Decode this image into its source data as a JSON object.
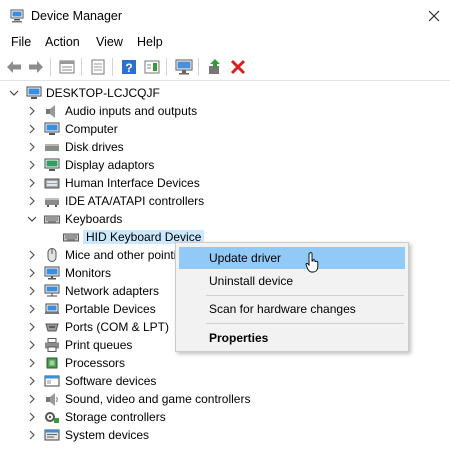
{
  "window": {
    "title": "Device Manager",
    "close_glyph": "✕"
  },
  "menu": [
    "File",
    "Action",
    "View",
    "Help"
  ],
  "toolbar": {
    "buttons": [
      "back-icon",
      "forward-icon",
      "properties-sheet-icon",
      "show-hidden-icon",
      "help-icon",
      "action-pane-icon",
      "scan-monitor-icon",
      "update-driver-icon",
      "uninstall-icon"
    ]
  },
  "tree": {
    "root": "DESKTOP-LCJCQJF",
    "items": [
      {
        "label": "Audio inputs and outputs",
        "icon": "speaker-icon",
        "expanded": false
      },
      {
        "label": "Computer",
        "icon": "computer-icon",
        "expanded": false
      },
      {
        "label": "Disk drives",
        "icon": "disk-drive-icon",
        "expanded": false
      },
      {
        "label": "Display adaptors",
        "icon": "display-adapter-icon",
        "expanded": false
      },
      {
        "label": "Human Interface Devices",
        "icon": "hid-icon",
        "expanded": false
      },
      {
        "label": "IDE ATA/ATAPI controllers",
        "icon": "ide-controller-icon",
        "expanded": false
      },
      {
        "label": "Keyboards",
        "icon": "keyboard-icon",
        "expanded": true
      },
      {
        "label": "HID Keyboard Device",
        "icon": "keyboard-icon",
        "child": true,
        "selected": true
      },
      {
        "label": "Mice and other pointi",
        "icon": "mouse-icon",
        "expanded": false
      },
      {
        "label": "Monitors",
        "icon": "monitor-icon",
        "expanded": false
      },
      {
        "label": "Network adapters",
        "icon": "network-adapter-icon",
        "expanded": false
      },
      {
        "label": "Portable Devices",
        "icon": "portable-device-icon",
        "expanded": false
      },
      {
        "label": "Ports (COM & LPT)",
        "icon": "port-icon",
        "expanded": false
      },
      {
        "label": "Print queues",
        "icon": "printer-icon",
        "expanded": false
      },
      {
        "label": "Processors",
        "icon": "processor-icon",
        "expanded": false
      },
      {
        "label": "Software devices",
        "icon": "software-device-icon",
        "expanded": false
      },
      {
        "label": "Sound, video and game controllers",
        "icon": "sound-controller-icon",
        "expanded": false
      },
      {
        "label": "Storage controllers",
        "icon": "storage-controller-icon",
        "expanded": false
      },
      {
        "label": "System devices",
        "icon": "system-device-icon",
        "expanded": false
      }
    ]
  },
  "context_menu": {
    "items": [
      {
        "label": "Update driver",
        "hover": true
      },
      {
        "label": "Uninstall device"
      },
      {
        "label": "Scan for hardware changes"
      },
      {
        "label": "Properties",
        "bold": true
      }
    ]
  },
  "colors": {
    "selection": "#cce8ff",
    "menu_hover": "#91c9f7",
    "accent_blue": "#1e73c8",
    "error_red": "#d61f1f",
    "arrow_green": "#2e9e3e"
  }
}
